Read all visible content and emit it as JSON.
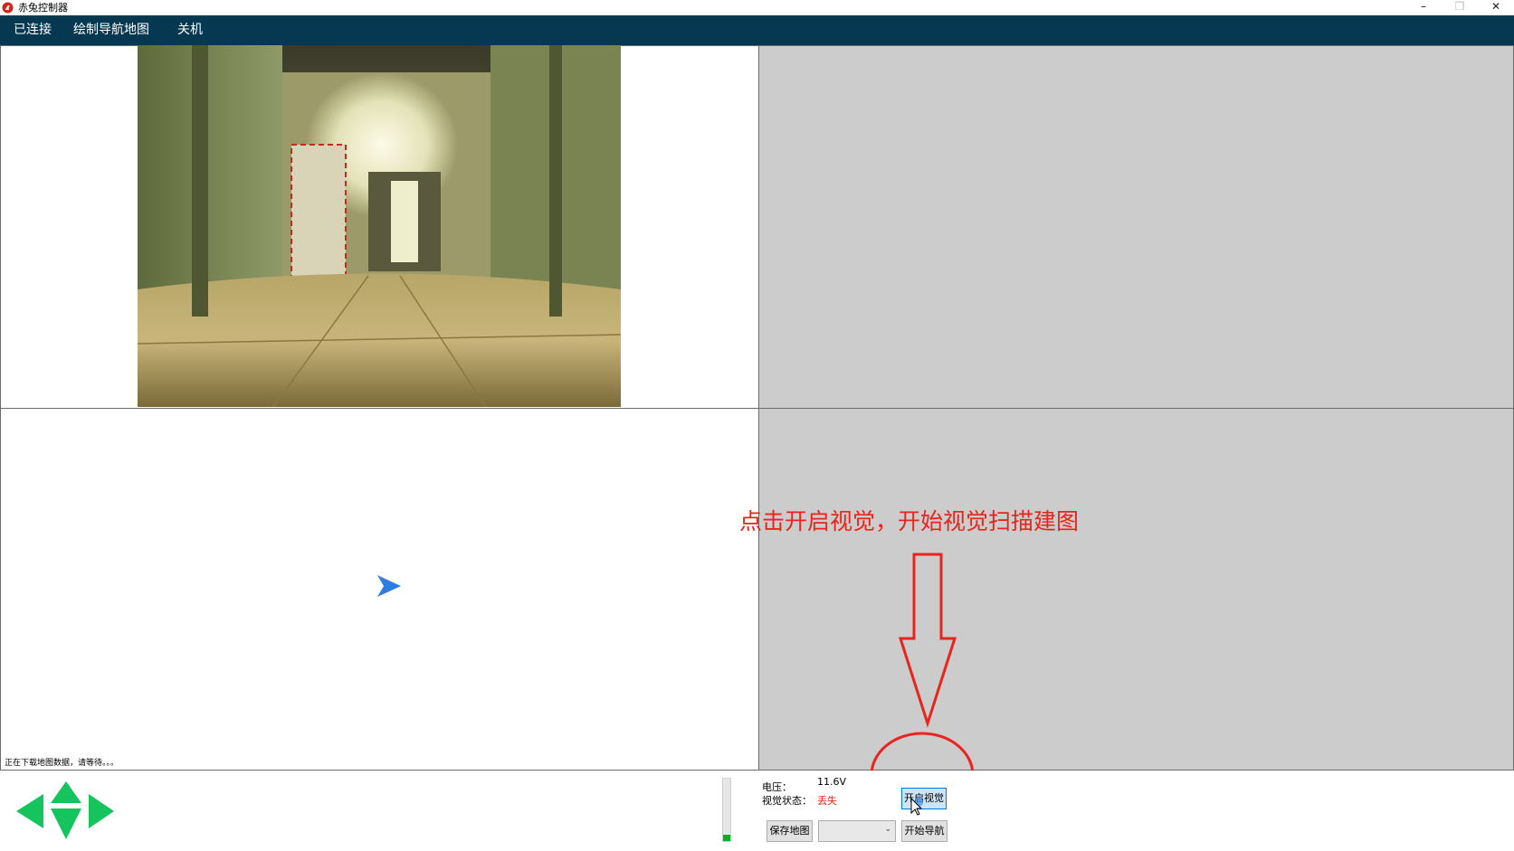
{
  "window": {
    "title": "赤兔控制器",
    "minimize": "–",
    "maximize": "❐",
    "close": "✕"
  },
  "menu": {
    "items": [
      "已连接",
      "绘制导航地图",
      "关机"
    ]
  },
  "annotation": {
    "hint": "点击开启视觉，开始视觉扫描建图"
  },
  "status": {
    "message": "正在下载地图数据，请等待。。。"
  },
  "controls": {
    "voltage_label": "电压：",
    "voltage_value": "11.6V",
    "vision_state_label": "视觉状态：",
    "vision_state_value": "丢失",
    "vision_state_color": "#e8241d",
    "open_vision_button": "开启视觉",
    "save_map_button": "保存地图",
    "map_select_value": "",
    "start_nav_button": "开始导航",
    "level_fraction": 0.1
  },
  "icons": {
    "app": "red-rabbit-icon",
    "robot": "blue-arrow-marker-icon",
    "direction_pad": [
      "arrow-left-icon",
      "arrow-up-icon",
      "arrow-down-icon",
      "arrow-right-icon"
    ]
  },
  "colors": {
    "menubar": "#063852",
    "map_background": "#cccccc",
    "arrow": "#16c45e",
    "annotation": "#e8241d",
    "robot": "#2f7de1"
  }
}
